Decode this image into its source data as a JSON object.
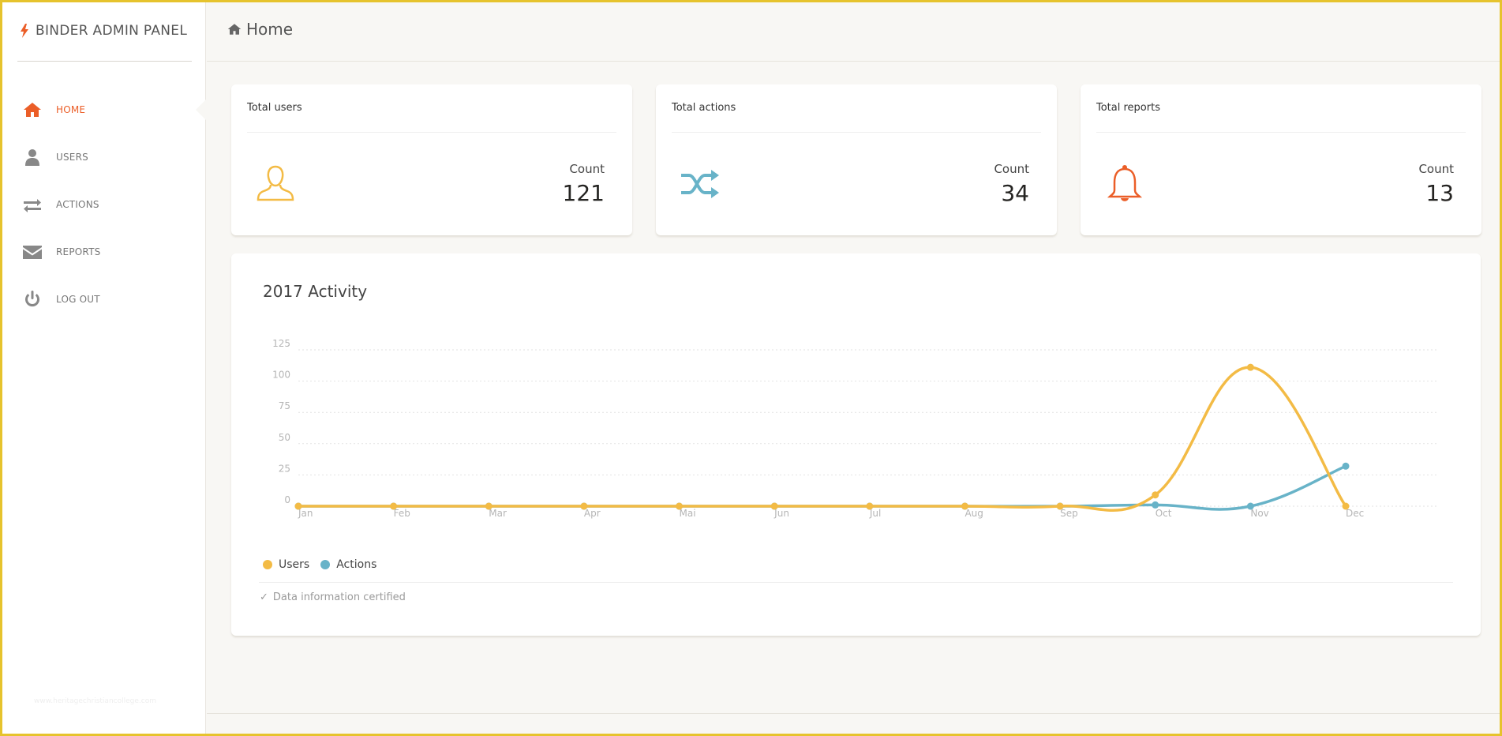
{
  "brand": {
    "title": "BINDER ADMIN PANEL",
    "accent": "#eb5e28"
  },
  "nav": [
    {
      "label": "HOME",
      "icon": "home-icon",
      "active": true
    },
    {
      "label": "USERS",
      "icon": "user-icon",
      "active": false
    },
    {
      "label": "ACTIONS",
      "icon": "exchange-icon",
      "active": false
    },
    {
      "label": "REPORTS",
      "icon": "envelope-icon",
      "active": false
    },
    {
      "label": "LOG OUT",
      "icon": "power-icon",
      "active": false
    }
  ],
  "watermark": "www.heritagechristiancollege.com",
  "topbar": {
    "title": "Home"
  },
  "stats": [
    {
      "title": "Total users",
      "label": "Count",
      "value": "121",
      "icon": "user-outline-icon",
      "color": "#f3bb45"
    },
    {
      "title": "Total actions",
      "label": "Count",
      "value": "34",
      "icon": "shuffle-icon",
      "color": "#68b3c8"
    },
    {
      "title": "Total reports",
      "label": "Count",
      "value": "13",
      "icon": "bell-icon",
      "color": "#eb5e28"
    }
  ],
  "chart": {
    "title": "2017 Activity",
    "legend": [
      {
        "name": "Users",
        "color": "#f3bb45"
      },
      {
        "name": "Actions",
        "color": "#68b3c8"
      }
    ],
    "footer": "Data information certified"
  },
  "chart_data": {
    "type": "line",
    "title": "2017 Activity",
    "categories": [
      "Jan",
      "Feb",
      "Mar",
      "Apr",
      "Mai",
      "Jun",
      "Jul",
      "Aug",
      "Sep",
      "Oct",
      "Nov",
      "Dec"
    ],
    "series": [
      {
        "name": "Users",
        "color": "#f3bb45",
        "values": [
          0,
          0,
          0,
          0,
          0,
          0,
          0,
          0,
          0,
          9,
          111,
          0
        ]
      },
      {
        "name": "Actions",
        "color": "#68b3c8",
        "values": [
          0,
          0,
          0,
          0,
          0,
          0,
          0,
          0,
          0,
          1,
          0,
          32
        ]
      }
    ],
    "yticks": [
      0,
      25,
      50,
      75,
      100,
      125
    ],
    "ylim": [
      0,
      125
    ],
    "grid": true,
    "legend_position": "bottom-left"
  }
}
